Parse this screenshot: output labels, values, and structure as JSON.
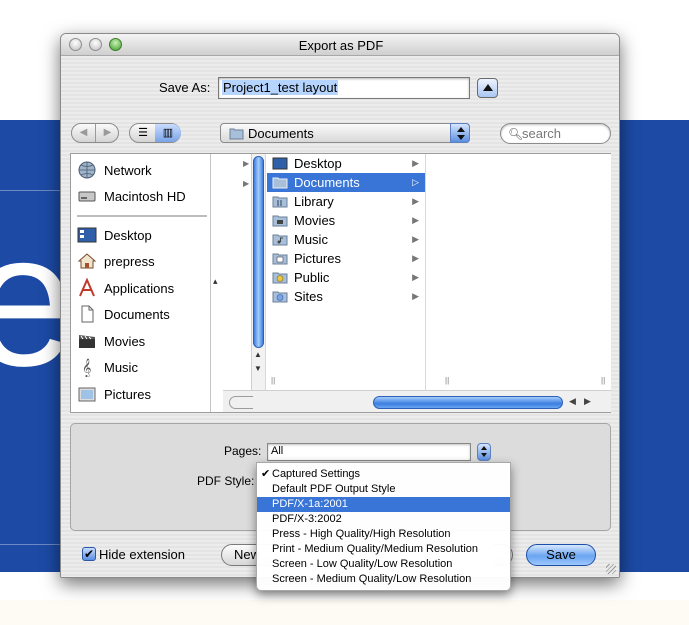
{
  "window": {
    "title": "Export as PDF"
  },
  "save_as": {
    "label": "Save As:",
    "value": "Project1_test layout"
  },
  "toolbar": {
    "path_popup": "Documents",
    "search_placeholder": "search"
  },
  "sidebar": {
    "items": [
      {
        "label": "Network",
        "icon": "globe-icon"
      },
      {
        "label": "Macintosh HD",
        "icon": "hard-drive-icon"
      },
      {
        "label": "Desktop",
        "icon": "desktop-icon"
      },
      {
        "label": "prepress",
        "icon": "home-icon"
      },
      {
        "label": "Applications",
        "icon": "applications-icon"
      },
      {
        "label": "Documents",
        "icon": "document-icon"
      },
      {
        "label": "Movies",
        "icon": "movies-icon"
      },
      {
        "label": "Music",
        "icon": "music-icon"
      },
      {
        "label": "Pictures",
        "icon": "pictures-icon"
      }
    ]
  },
  "browser": {
    "column2": [
      {
        "label": "Desktop",
        "icon": "desktop-folder-icon"
      },
      {
        "label": "Documents",
        "icon": "documents-folder-icon",
        "selected": true
      },
      {
        "label": "Library",
        "icon": "library-folder-icon"
      },
      {
        "label": "Movies",
        "icon": "movies-folder-icon"
      },
      {
        "label": "Music",
        "icon": "music-folder-icon"
      },
      {
        "label": "Pictures",
        "icon": "pictures-folder-icon"
      },
      {
        "label": "Public",
        "icon": "public-folder-icon"
      },
      {
        "label": "Sites",
        "icon": "sites-folder-icon"
      }
    ]
  },
  "options": {
    "pages_label": "Pages:",
    "pages_value": "All",
    "pdf_style_label": "PDF Style:"
  },
  "pdf_style_menu": {
    "items": [
      {
        "label": "Captured Settings",
        "checked": true
      },
      {
        "label": "Default PDF Output Style"
      },
      {
        "label": "PDF/X-1a:2001",
        "highlighted": true
      },
      {
        "label": "PDF/X-3:2002"
      },
      {
        "label": "Press - High Quality/High Resolution"
      },
      {
        "label": "Print - Medium Quality/Medium Resolution"
      },
      {
        "label": "Screen - Low Quality/Low Resolution"
      },
      {
        "label": "Screen - Medium Quality/Low Resolution"
      }
    ]
  },
  "footer": {
    "hide_extension_label": "Hide extension",
    "hide_extension_checked": true,
    "new_folder_label": "New",
    "save_label": "Save"
  },
  "colors": {
    "desktop_blue": "#1c4aa5",
    "selection_blue": "#3875d7"
  }
}
